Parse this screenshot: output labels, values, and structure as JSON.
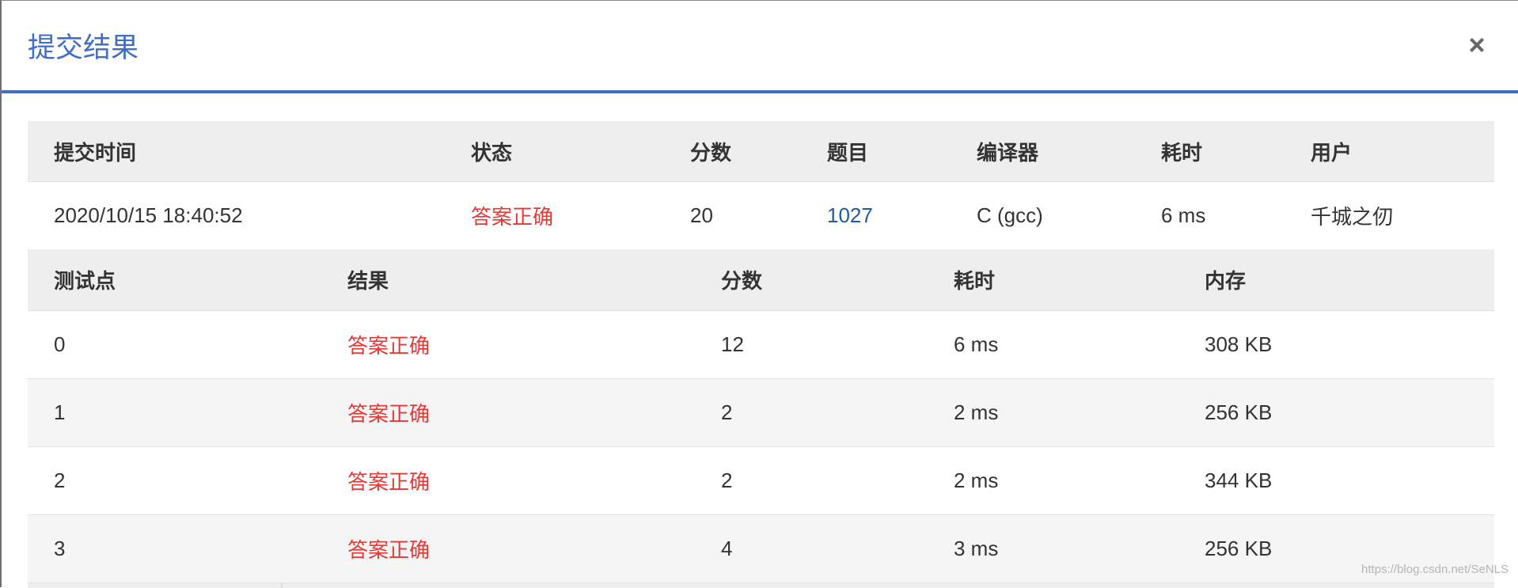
{
  "modal": {
    "title": "提交结果",
    "close_label": "×"
  },
  "summary": {
    "headers": [
      "提交时间",
      "状态",
      "分数",
      "题目",
      "编译器",
      "耗时",
      "用户"
    ],
    "row": {
      "time": "2020/10/15 18:40:52",
      "status": "答案正确",
      "score": "20",
      "problem": "1027",
      "compiler": "C (gcc)",
      "duration": "6 ms",
      "user": "千城之仞"
    }
  },
  "cases": {
    "headers": [
      "测试点",
      "结果",
      "分数",
      "耗时",
      "内存"
    ],
    "rows": [
      {
        "id": "0",
        "result": "答案正确",
        "score": "12",
        "time": "6 ms",
        "memory": "308 KB"
      },
      {
        "id": "1",
        "result": "答案正确",
        "score": "2",
        "time": "2 ms",
        "memory": "256 KB"
      },
      {
        "id": "2",
        "result": "答案正确",
        "score": "2",
        "time": "2 ms",
        "memory": "344 KB"
      },
      {
        "id": "3",
        "result": "答案正确",
        "score": "4",
        "time": "3 ms",
        "memory": "256 KB"
      }
    ]
  },
  "watermark": "https://blog.csdn.net/SeNLS",
  "colors": {
    "accent": "#3f6fc4",
    "accepted": "#e53935",
    "link": "#1e5aa8",
    "header_bg": "#eeeeee"
  }
}
